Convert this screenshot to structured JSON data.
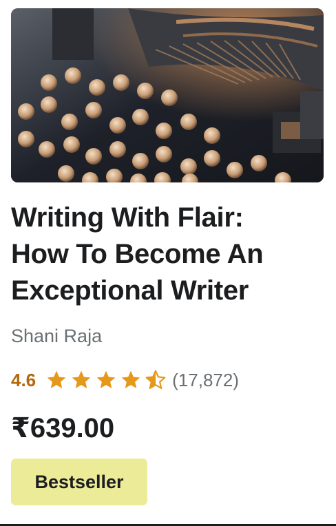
{
  "course": {
    "image_icon": "typewriter-image",
    "title_lines": [
      "Writing With Flair:",
      "How To Become An",
      "Exceptional Writer"
    ],
    "author": "Shani Raja",
    "rating": {
      "value": "4.6",
      "stars": 4.6,
      "count": "(17,872)"
    },
    "price": "₹639.00",
    "badge": "Bestseller"
  },
  "colors": {
    "rating_orange": "#b4690e",
    "star_fill": "#e59819",
    "badge_bg": "#eceb98",
    "text_primary": "#1c1d1f",
    "text_secondary": "#6a6f73"
  }
}
